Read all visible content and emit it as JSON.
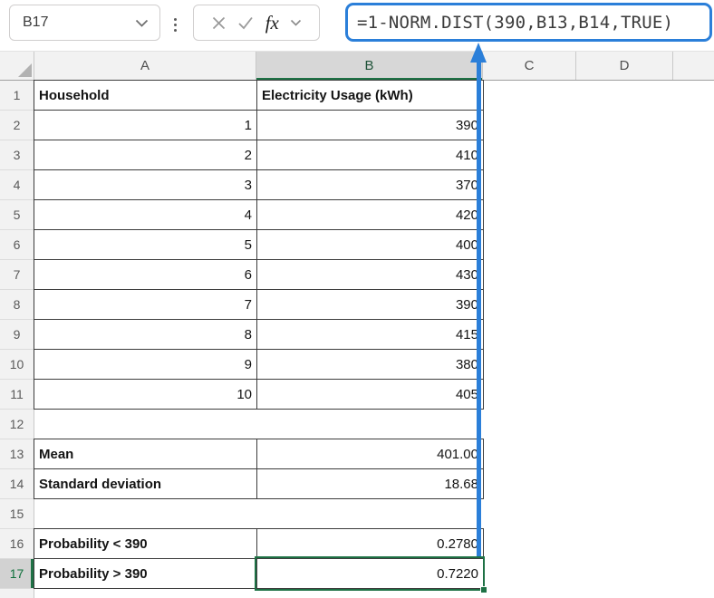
{
  "name_box": {
    "value": "B17"
  },
  "formula_bar": {
    "formula": "=1-NORM.DIST(390,B13,B14,TRUE)",
    "fx_label": "fx"
  },
  "colors": {
    "annotation_blue": "#2b7fd9",
    "selection_green": "#1e7145",
    "selected_header_text": "#0f703b",
    "label_cell_fill": "#e9e9e9",
    "header_fill": "#f2f2f2",
    "selected_header_fill": "#d7d7d7"
  },
  "sheet": {
    "selected_cell": "B17",
    "columns": [
      {
        "label": "A",
        "selected": false
      },
      {
        "label": "B",
        "selected": true
      },
      {
        "label": "C",
        "selected": false
      },
      {
        "label": "D",
        "selected": false
      }
    ],
    "rows": [
      {
        "num": "1",
        "a": {
          "text": "Household",
          "type": "label"
        },
        "b": {
          "text": "Electricity Usage (kWh)",
          "type": "label"
        },
        "bordered": true
      },
      {
        "num": "2",
        "a": {
          "text": "1",
          "type": "number"
        },
        "b": {
          "text": "390",
          "type": "number"
        },
        "bordered": true
      },
      {
        "num": "3",
        "a": {
          "text": "2",
          "type": "number"
        },
        "b": {
          "text": "410",
          "type": "number"
        },
        "bordered": true
      },
      {
        "num": "4",
        "a": {
          "text": "3",
          "type": "number"
        },
        "b": {
          "text": "370",
          "type": "number"
        },
        "bordered": true
      },
      {
        "num": "5",
        "a": {
          "text": "4",
          "type": "number"
        },
        "b": {
          "text": "420",
          "type": "number"
        },
        "bordered": true
      },
      {
        "num": "6",
        "a": {
          "text": "5",
          "type": "number"
        },
        "b": {
          "text": "400",
          "type": "number"
        },
        "bordered": true
      },
      {
        "num": "7",
        "a": {
          "text": "6",
          "type": "number"
        },
        "b": {
          "text": "430",
          "type": "number"
        },
        "bordered": true
      },
      {
        "num": "8",
        "a": {
          "text": "7",
          "type": "number"
        },
        "b": {
          "text": "390",
          "type": "number"
        },
        "bordered": true
      },
      {
        "num": "9",
        "a": {
          "text": "8",
          "type": "number"
        },
        "b": {
          "text": "415",
          "type": "number"
        },
        "bordered": true
      },
      {
        "num": "10",
        "a": {
          "text": "9",
          "type": "number"
        },
        "b": {
          "text": "380",
          "type": "number"
        },
        "bordered": true
      },
      {
        "num": "11",
        "a": {
          "text": "10",
          "type": "number"
        },
        "b": {
          "text": "405",
          "type": "number"
        },
        "bordered": true
      },
      {
        "num": "12",
        "a": {
          "text": "",
          "type": "empty"
        },
        "b": {
          "text": "",
          "type": "empty"
        },
        "bordered": false
      },
      {
        "num": "13",
        "a": {
          "text": "Mean",
          "type": "label"
        },
        "b": {
          "text": "401.00",
          "type": "number"
        },
        "bordered": true
      },
      {
        "num": "14",
        "a": {
          "text": "Standard deviation",
          "type": "label"
        },
        "b": {
          "text": "18.68",
          "type": "number"
        },
        "bordered": true
      },
      {
        "num": "15",
        "a": {
          "text": "",
          "type": "empty"
        },
        "b": {
          "text": "",
          "type": "empty"
        },
        "bordered": false
      },
      {
        "num": "16",
        "a": {
          "text": "Probability < 390",
          "type": "label"
        },
        "b": {
          "text": "0.2780",
          "type": "number"
        },
        "bordered": true
      },
      {
        "num": "17",
        "a": {
          "text": "Probability > 390",
          "type": "label"
        },
        "b": {
          "text": "0.7220",
          "type": "number"
        },
        "bordered": true,
        "selected_row": true
      }
    ]
  }
}
